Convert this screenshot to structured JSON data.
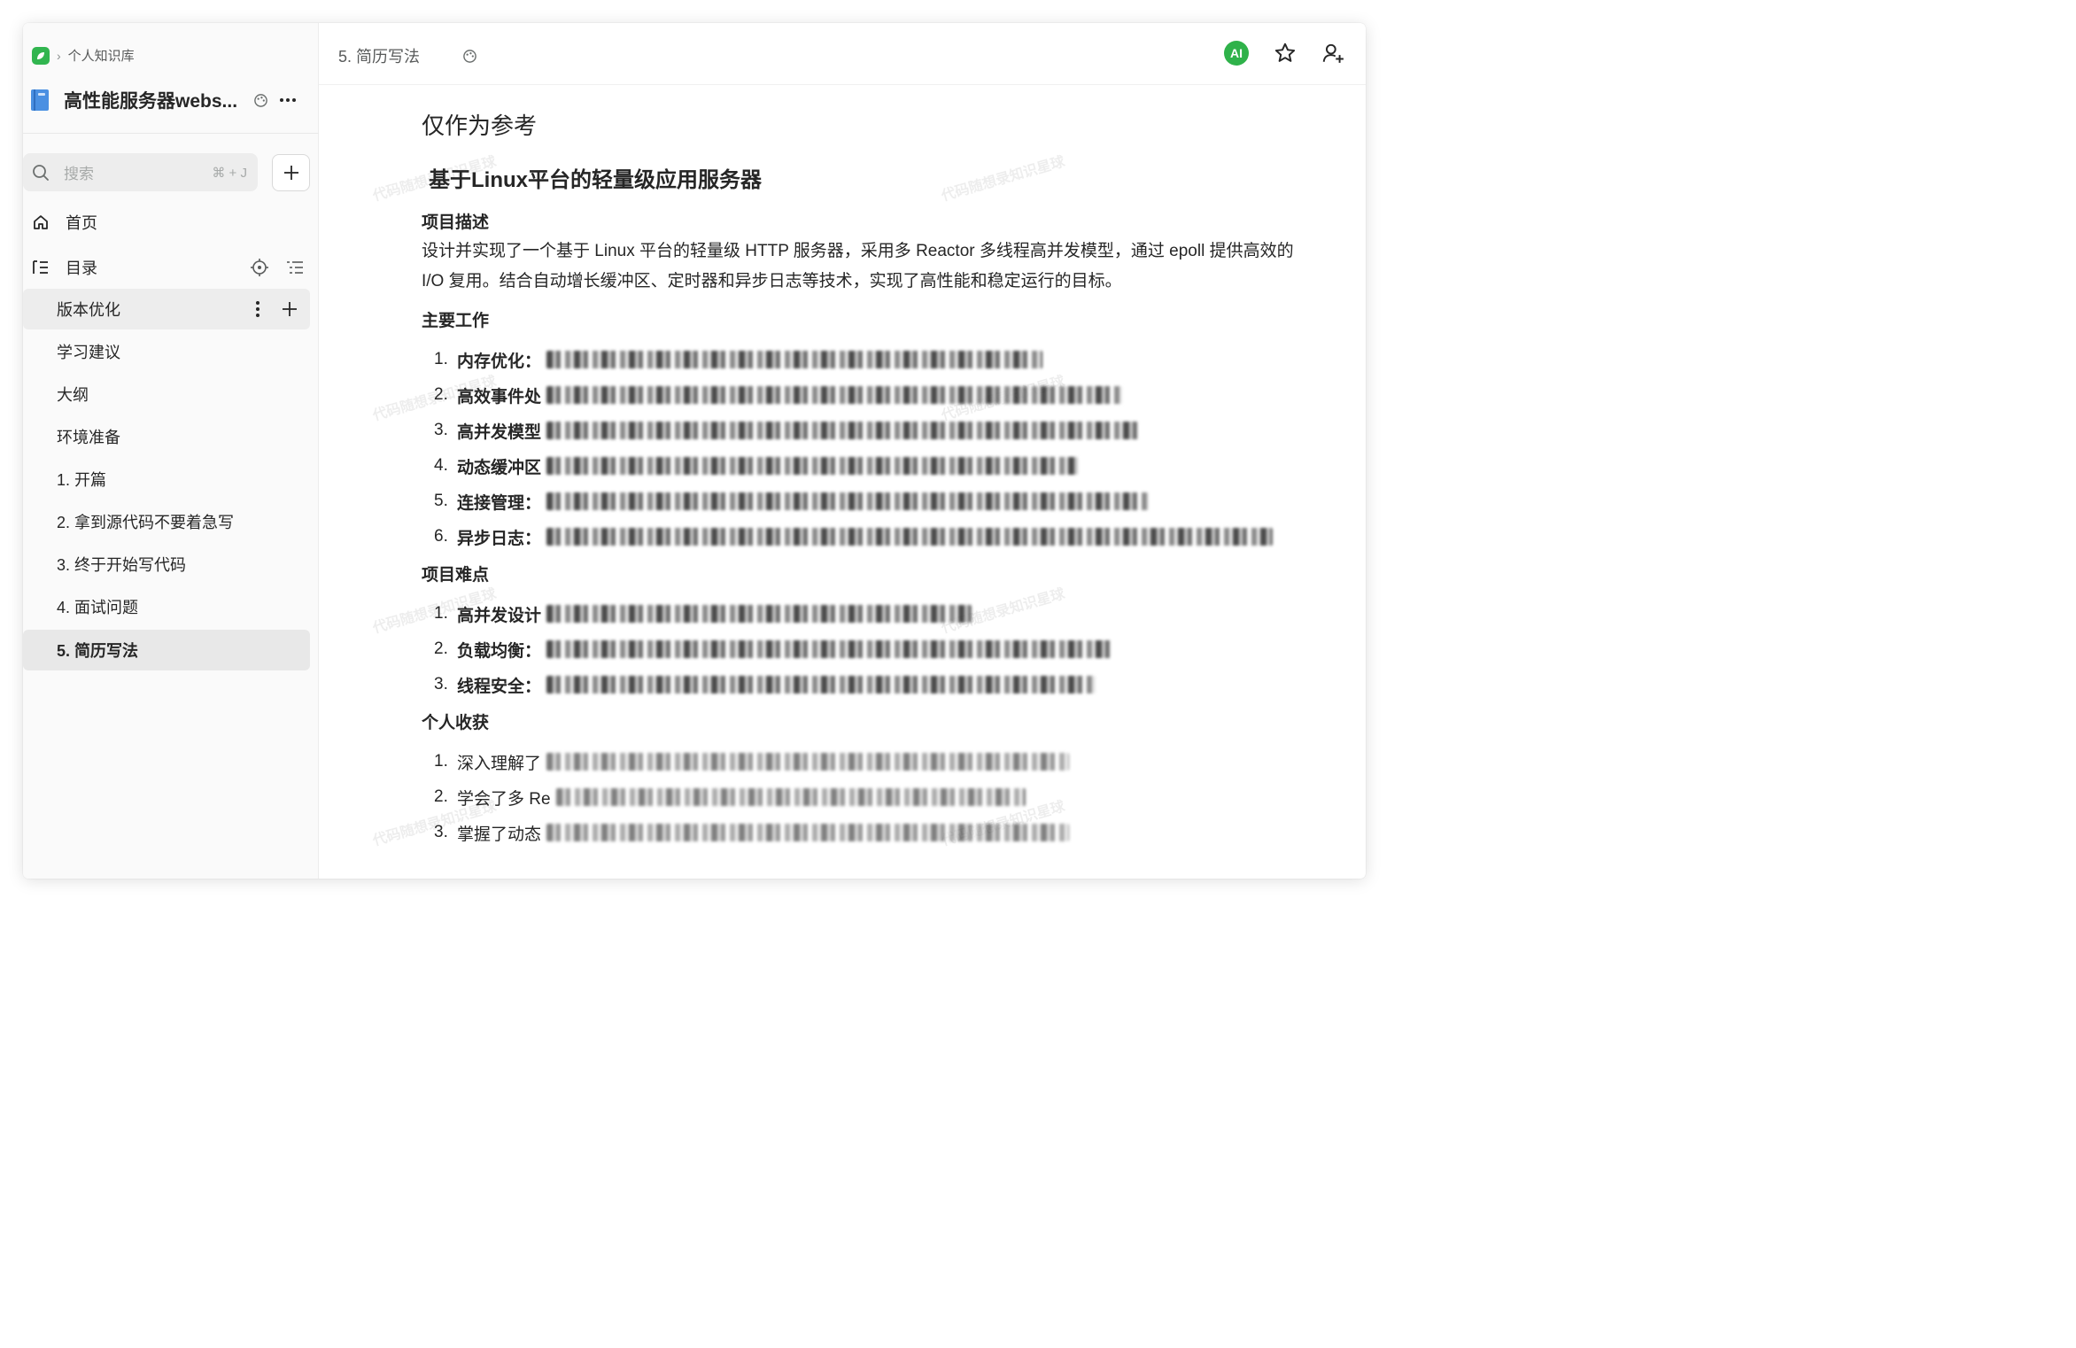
{
  "sidebar": {
    "breadcrumb": "个人知识库",
    "kb_title": "高性能服务器webs...",
    "search_placeholder": "搜索",
    "search_shortcut": "⌘ + J",
    "home_label": "首页",
    "toc_label": "目录",
    "toc_items": [
      "版本优化",
      "学习建议",
      "大纲",
      "环境准备",
      "1. 开篇",
      "2. 拿到源代码不要着急写",
      "3. 终于开始写代码",
      "4. 面试问题",
      "5. 简历写法"
    ]
  },
  "header": {
    "doc_title": "5. 简历写法",
    "ai_label": "AI"
  },
  "doc": {
    "lead": "仅作为参考",
    "title": "基于Linux平台的轻量级应用服务器",
    "sections": {
      "desc_heading": "项目描述",
      "desc_text": "设计并实现了一个基于 Linux 平台的轻量级 HTTP 服务器，采用多 Reactor 多线程高并发模型，通过 epoll 提供高效的 I/O 复用。结合自动增长缓冲区、定时器和异步日志等技术，实现了高性能和稳定运行的目标。",
      "work_heading": "主要工作",
      "work_items": [
        "内存优化：",
        "高效事件处",
        "高并发模型",
        "动态缓冲区",
        "连接管理：",
        "异步日志："
      ],
      "hard_heading": "项目难点",
      "hard_items": [
        "高并发设计",
        "负载均衡：",
        "线程安全："
      ],
      "gain_heading": "个人收获",
      "gain_items": [
        "深入理解了",
        "学会了多 Re",
        "掌握了动态"
      ]
    }
  },
  "watermark": "代码随想录知识星球",
  "colors": {
    "brand_green": "#31b54f",
    "ai_green": "#2fb24a",
    "active_bg": "#e8e8e8"
  }
}
